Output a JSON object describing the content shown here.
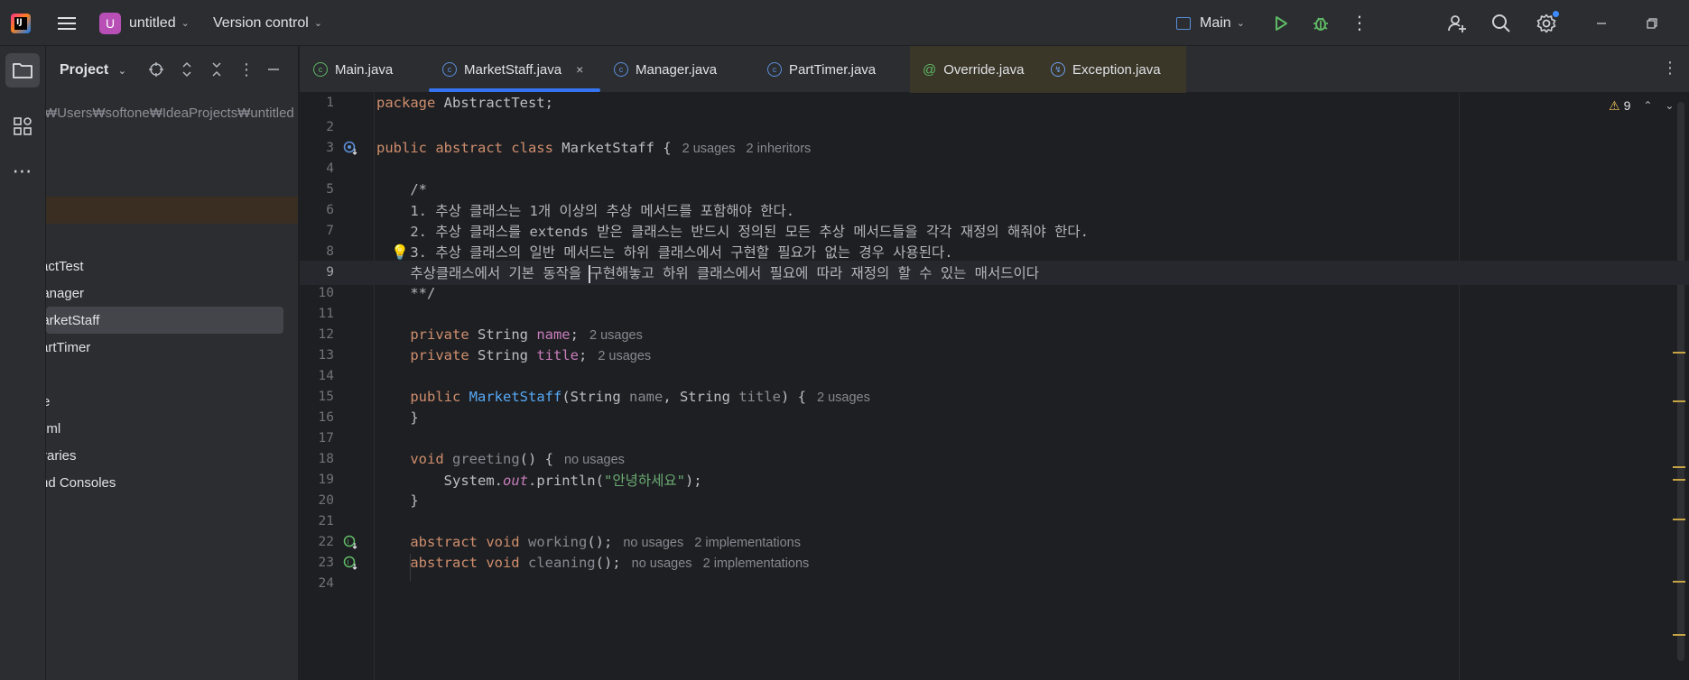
{
  "titlebar": {
    "project_badge": "U",
    "project_name": "untitled",
    "vcs_label": "Version control",
    "run_config": "Main"
  },
  "project_panel": {
    "title": "Project",
    "path_text": "₩Users₩softone₩IdeaProjects₩untitled",
    "tree": [
      "actTest",
      "lanager",
      "larketStaff",
      "artTimer",
      "e",
      "iml",
      "raries",
      "nd Consoles"
    ]
  },
  "tabs": [
    {
      "label": "Main.java"
    },
    {
      "label": "MarketStaff.java",
      "close": "×"
    },
    {
      "label": "Manager.java"
    },
    {
      "label": "PartTimer.java"
    },
    {
      "label": "Override.java"
    },
    {
      "label": "Exception.java"
    }
  ],
  "editor": {
    "warnings_count": "9",
    "lines": {
      "l1": {
        "num": "1",
        "kw": "package",
        "rest": " AbstractTest;"
      },
      "l2": {
        "num": "2"
      },
      "l3": {
        "num": "3",
        "kw": "public abstract class",
        "rest": " MarketStaff {",
        "hint": "2 usages   2 inheritors"
      },
      "l4": {
        "num": "4"
      },
      "l5": {
        "num": "5",
        "text": "    /*"
      },
      "l6": {
        "num": "6",
        "text": "    1. 추상 클래스는 1개 이상의 추상 메서드를 포함해야 한다."
      },
      "l7": {
        "num": "7",
        "text": "    2. 추상 클래스를 extends 받은 클래스는 반드시 정의된 모든 추상 메서드들을 각각 재정의 해줘야 한다."
      },
      "l8": {
        "num": "8",
        "text": "    3. 추상 클래스의 일반 메서드는 하위 클래스에서 구현할 필요가 없는 경우 사용된다."
      },
      "l9": {
        "num": "9",
        "before_caret": "    추상클래스에서 기본 동작을 ",
        "after_caret": "구현해놓고 하위 클래스에서 필요에 따라 재정의 할 수 있는 매서드이다"
      },
      "l10": {
        "num": "10",
        "text": "    **/"
      },
      "l11": {
        "num": "11"
      },
      "l12": {
        "num": "12",
        "kw": "    private",
        "type": " String ",
        "field": "name",
        "semi": ";",
        "hint": "2 usages"
      },
      "l13": {
        "num": "13",
        "kw": "    private",
        "type": " String ",
        "field": "title",
        "semi": ";",
        "hint": "2 usages"
      },
      "l14": {
        "num": "14"
      },
      "l15": {
        "num": "15",
        "kw": "    public",
        "sp": " ",
        "fn": "MarketStaff",
        "p1": "(String ",
        "a1": "name",
        "p2": ", String ",
        "a2": "title",
        "p3": ") {",
        "hint": "2 usages"
      },
      "l16": {
        "num": "16",
        "text": "    }"
      },
      "l17": {
        "num": "17"
      },
      "l18": {
        "num": "18",
        "kw": "    void",
        "sp": " ",
        "fn": "greeting",
        "rest": "() {",
        "hint": "no usages"
      },
      "l19": {
        "num": "19",
        "p1": "        System.",
        "stat": "out",
        "p2": ".println(",
        "str": "\"안녕하세요\"",
        "p3": ");"
      },
      "l20": {
        "num": "20",
        "text": "    }"
      },
      "l21": {
        "num": "21"
      },
      "l22": {
        "num": "22",
        "kw": "    abstract void",
        "sp": " ",
        "fn": "working",
        "rest": "();",
        "hint": "no usages   2 implementations"
      },
      "l23": {
        "num": "23",
        "kw": "    abstract void",
        "sp": " ",
        "fn": "cleaning",
        "rest": "();",
        "hint": "no usages   2 implementations"
      },
      "l24": {
        "num": "24"
      }
    }
  }
}
